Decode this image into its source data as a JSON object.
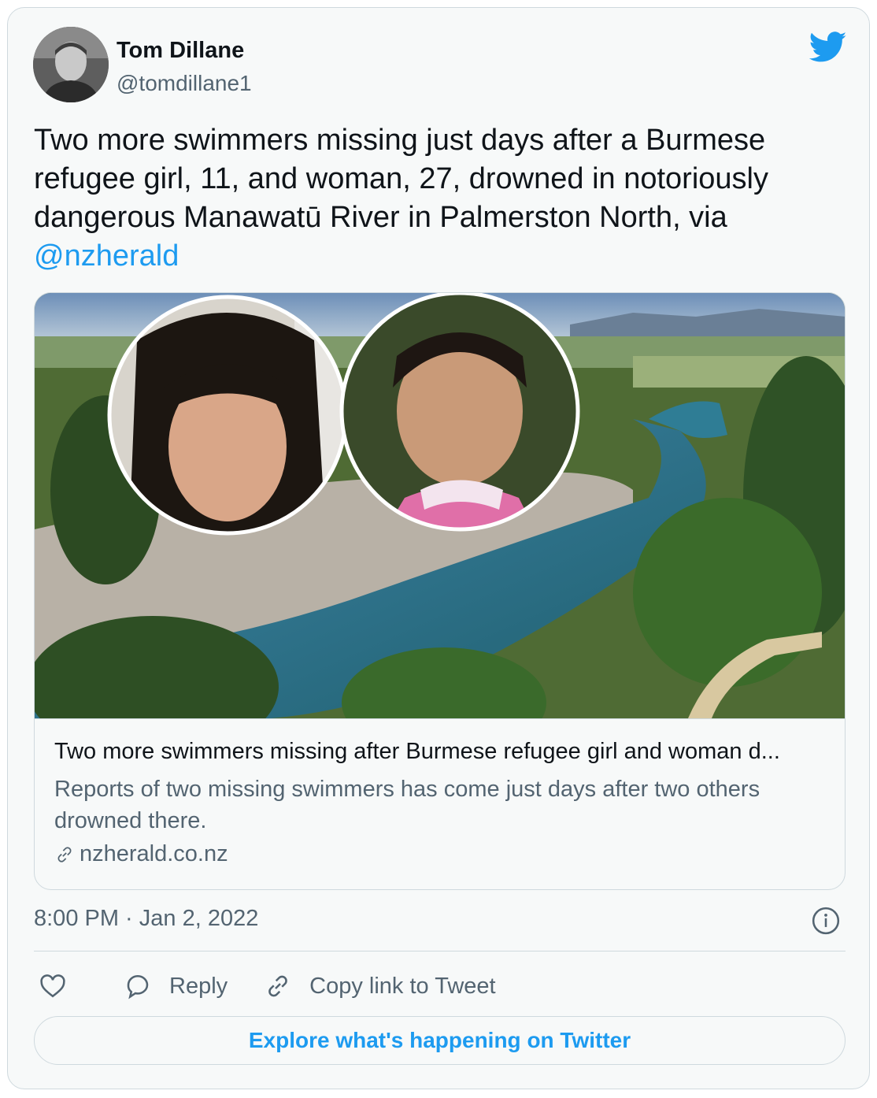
{
  "author": {
    "name": "Tom Dillane",
    "handle": "@tomdillane1",
    "avatar_icon": "profile-photo"
  },
  "tweet": {
    "text": "Two more swimmers missing just days after a Burmese refugee girl, 11, and woman, 27, drowned in notoriously dangerous Manawatū River in Palmerston North, via ",
    "mention": "@nzherald"
  },
  "link_card": {
    "title": "Two more swimmers missing after Burmese refugee girl and woman d...",
    "description": "Reports of two missing swimmers has come just days after two others drowned there.",
    "domain": "nzherald.co.nz",
    "image_icon": "news-photo-river-with-portraits"
  },
  "meta": {
    "timestamp": "8:00 PM · Jan 2, 2022"
  },
  "actions": {
    "reply_label": "Reply",
    "copy_link_label": "Copy link to Tweet"
  },
  "explore": {
    "label": "Explore what's happening on Twitter"
  },
  "colors": {
    "accent": "#1d9bf0",
    "text": "#0f1419",
    "secondary_text": "#536471",
    "border": "#cfd9de",
    "background": "#f7f9f9"
  }
}
